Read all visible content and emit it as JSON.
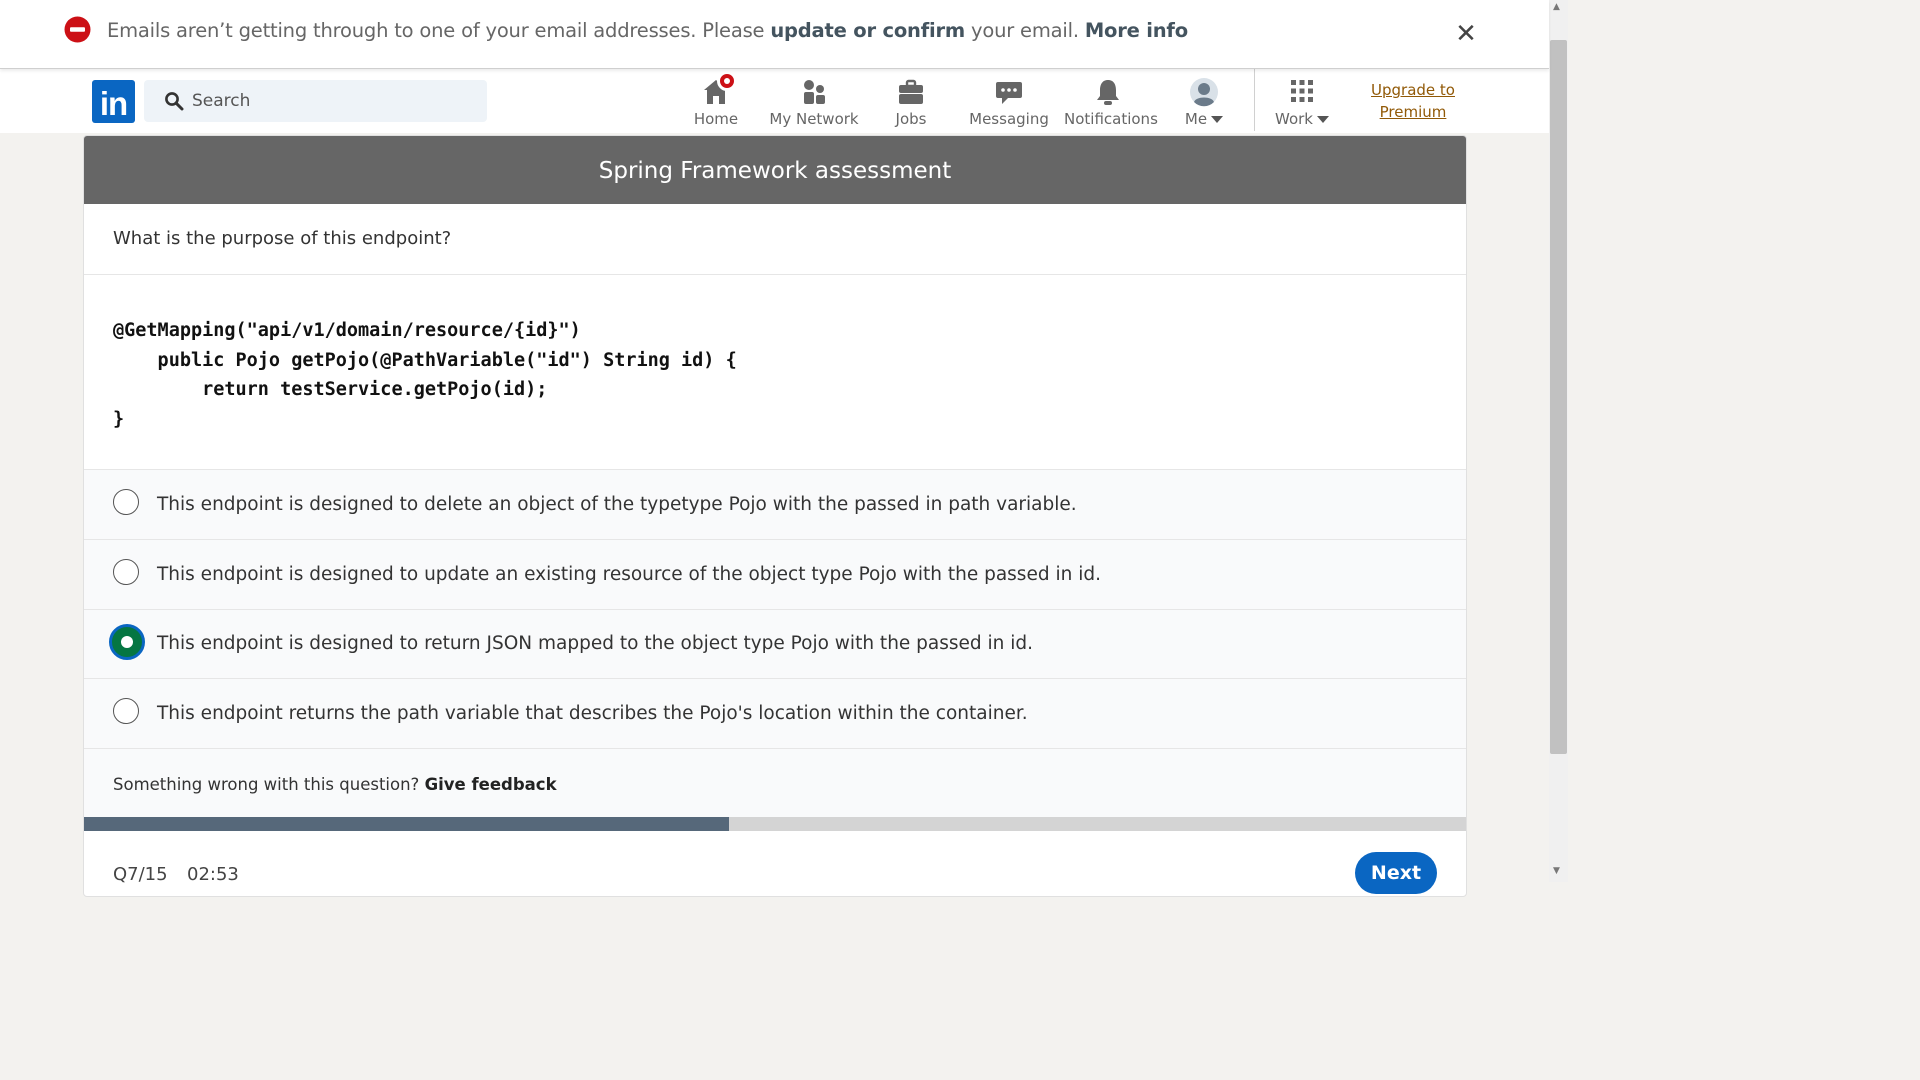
{
  "alert": {
    "text_before": "Emails aren’t getting through to one of your email addresses. Please ",
    "link_update": "update or confirm",
    "text_middle": " your email. ",
    "link_more": "More info",
    "close_symbol": "✕",
    "icon": "no-entry-icon",
    "color": "#cc1016"
  },
  "nav": {
    "logo_text": "in",
    "search_placeholder": "Search",
    "items": [
      {
        "label": "Home",
        "icon": "home-icon"
      },
      {
        "label": "My Network",
        "icon": "network-icon"
      },
      {
        "label": "Jobs",
        "icon": "briefcase-icon"
      },
      {
        "label": "Messaging",
        "icon": "messaging-icon"
      },
      {
        "label": "Notifications",
        "icon": "bell-icon"
      },
      {
        "label": "Me",
        "icon": "avatar-icon"
      },
      {
        "label": "Work",
        "icon": "grid-icon"
      }
    ],
    "premium_line1": "Upgrade to",
    "premium_line2": "Premium",
    "brand_color": "#0a66c2"
  },
  "assessment": {
    "title": "Spring Framework assessment",
    "question": "What is the purpose of this endpoint?",
    "code": [
      "@GetMapping(\"api/v1/domain/resource/{id}\")",
      "    public Pojo getPojo(@PathVariable(\"id\") String id) {",
      "        return testService.getPojo(id);",
      "}"
    ],
    "options": [
      {
        "text": "This endpoint is designed to delete an object of the typetype Pojo with the passed in path variable.",
        "selected": false
      },
      {
        "text": "This endpoint is designed to update an existing resource of the object type Pojo with the passed in id.",
        "selected": false
      },
      {
        "text": "This endpoint is designed to return JSON mapped to the object type Pojo with the passed in id.",
        "selected": true
      },
      {
        "text": "This endpoint returns the path variable that describes the Pojo's location within the container.",
        "selected": false
      }
    ],
    "feedback_prompt": "Something wrong with this question?",
    "feedback_link": "Give feedback",
    "progress_fraction": 0.4667,
    "question_counter": "Q7/15",
    "timer": "02:53",
    "next_label": "Next",
    "selected_color": "#057642"
  }
}
